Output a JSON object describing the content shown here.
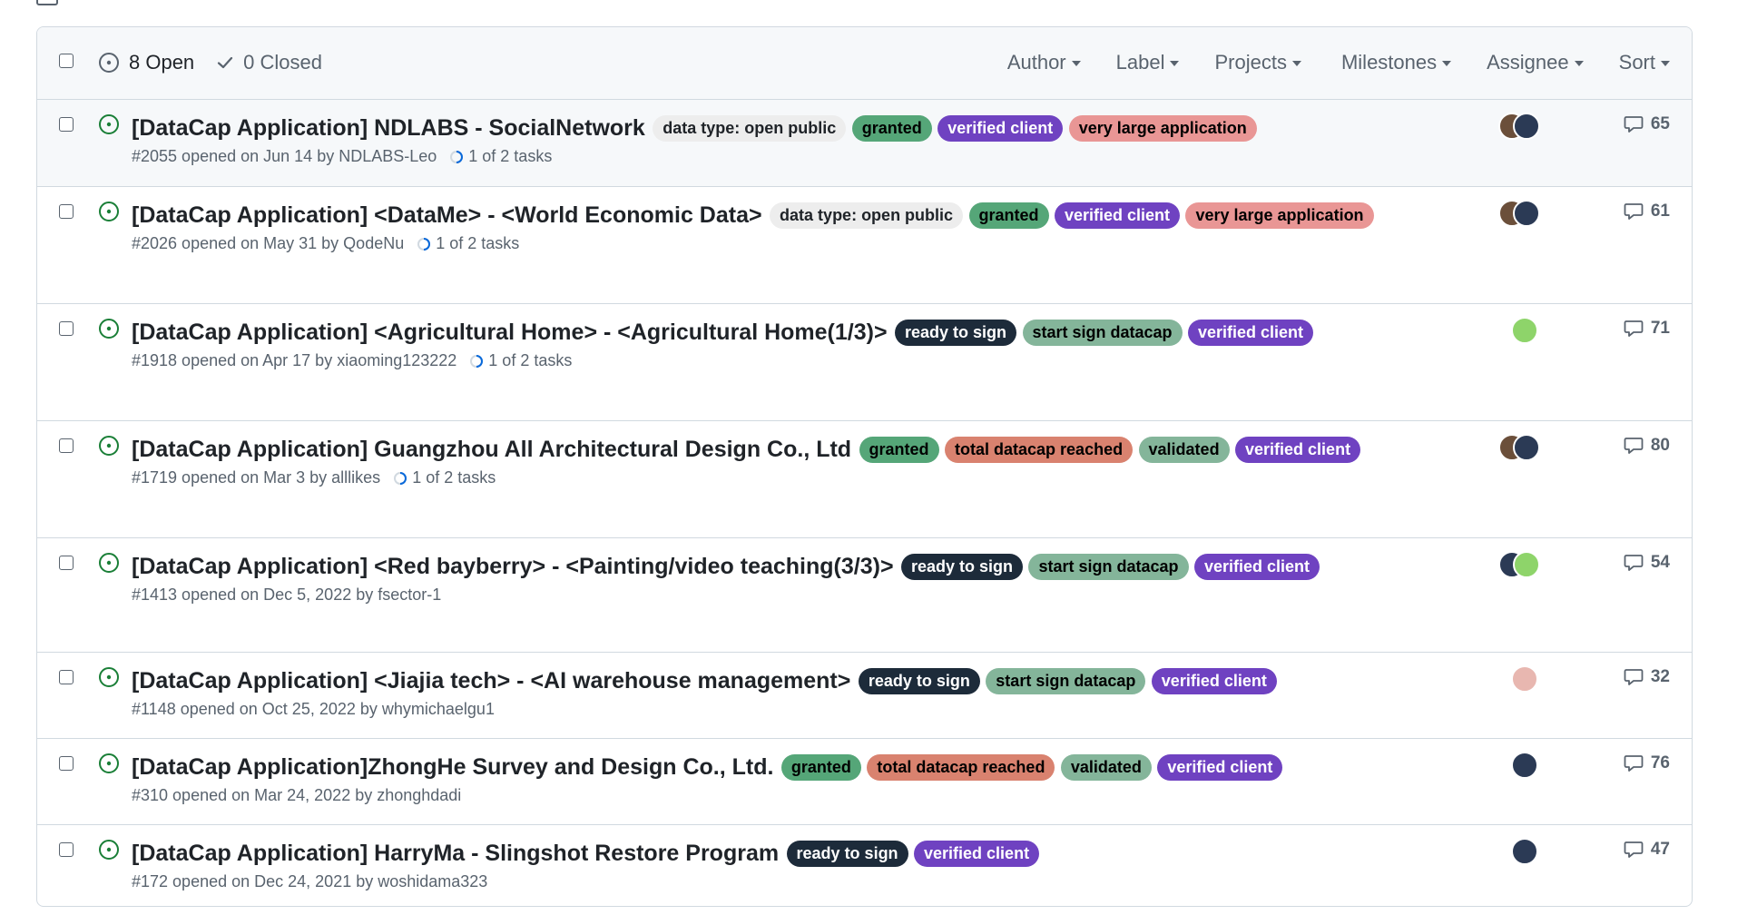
{
  "header": {
    "open_label": "8 Open",
    "closed_label": "0 Closed",
    "filters": [
      "Author",
      "Label",
      "Projects",
      "Milestones",
      "Assignee",
      "Sort"
    ]
  },
  "issues": [
    {
      "title": "[DataCap Application] NDLABS - SocialNetwork",
      "labels": [
        {
          "text": "data type: open public",
          "bg": "#ededed",
          "fg": "#1f2328"
        },
        {
          "text": "granted",
          "bg": "#55a678",
          "fg": "#000000"
        },
        {
          "text": "verified client",
          "bg": "#6f42c1",
          "fg": "#ffffff"
        },
        {
          "text": "very large application",
          "bg": "#e99695",
          "fg": "#000000"
        }
      ],
      "meta": "#2055 opened on Jun 14 by NDLABS-Leo",
      "tasks": "1 of 2 tasks",
      "comments": "65",
      "avatars": [
        "#6b4f3a",
        "#2b3a55"
      ]
    },
    {
      "title": "[DataCap Application] <DataMe> - <World Economic Data>",
      "labels": [
        {
          "text": "data type: open public",
          "bg": "#ededed",
          "fg": "#1f2328"
        },
        {
          "text": "granted",
          "bg": "#55a678",
          "fg": "#000000"
        },
        {
          "text": "verified client",
          "bg": "#6f42c1",
          "fg": "#ffffff"
        },
        {
          "text": "very large application",
          "bg": "#e99695",
          "fg": "#000000"
        }
      ],
      "meta": "#2026 opened on May 31 by QodeNu",
      "tasks": "1 of 2 tasks",
      "comments": "61",
      "avatars": [
        "#6b4f3a",
        "#2b3a55"
      ]
    },
    {
      "title": "[DataCap Application] <Agricultural Home> - <Agricultural Home(1/3)>",
      "labels": [
        {
          "text": "ready to sign",
          "bg": "#1d2b3a",
          "fg": "#ffffff"
        },
        {
          "text": "start sign datacap",
          "bg": "#84b59a",
          "fg": "#000000"
        },
        {
          "text": "verified client",
          "bg": "#6f42c1",
          "fg": "#ffffff"
        }
      ],
      "meta": "#1918 opened on Apr 17 by xiaoming123222",
      "tasks": "1 of 2 tasks",
      "comments": "71",
      "avatars": [
        "#8ed46a"
      ]
    },
    {
      "title": "[DataCap Application] Guangzhou All Architectural Design Co., Ltd",
      "labels": [
        {
          "text": "granted",
          "bg": "#55a678",
          "fg": "#000000"
        },
        {
          "text": "total datacap reached",
          "bg": "#d9826f",
          "fg": "#000000"
        },
        {
          "text": "validated",
          "bg": "#84b59a",
          "fg": "#000000"
        },
        {
          "text": "verified client",
          "bg": "#6f42c1",
          "fg": "#ffffff"
        }
      ],
      "meta": "#1719 opened on Mar 3 by alllikes",
      "tasks": "1 of 2 tasks",
      "comments": "80",
      "avatars": [
        "#6b4f3a",
        "#2b3a55"
      ]
    },
    {
      "title": "[DataCap Application] <Red bayberry> - <Painting/video teaching(3/3)>",
      "labels": [
        {
          "text": "ready to sign",
          "bg": "#1d2b3a",
          "fg": "#ffffff"
        },
        {
          "text": "start sign datacap",
          "bg": "#84b59a",
          "fg": "#000000"
        },
        {
          "text": "verified client",
          "bg": "#6f42c1",
          "fg": "#ffffff"
        }
      ],
      "meta": "#1413 opened on Dec 5, 2022 by fsector-1",
      "tasks": "",
      "comments": "54",
      "avatars": [
        "#2b3a55",
        "#8ed46a"
      ]
    },
    {
      "title": "[DataCap Application] <Jiajia tech> - <AI warehouse management>",
      "labels": [
        {
          "text": "ready to sign",
          "bg": "#1d2b3a",
          "fg": "#ffffff"
        },
        {
          "text": "start sign datacap",
          "bg": "#84b59a",
          "fg": "#000000"
        },
        {
          "text": "verified client",
          "bg": "#6f42c1",
          "fg": "#ffffff"
        }
      ],
      "meta": "#1148 opened on Oct 25, 2022 by whymichaelgu1",
      "tasks": "",
      "comments": "32",
      "avatars": [
        "#e8b7b0"
      ]
    },
    {
      "title": "[DataCap Application]ZhongHe Survey and Design Co., Ltd.",
      "labels": [
        {
          "text": "granted",
          "bg": "#55a678",
          "fg": "#000000"
        },
        {
          "text": "total datacap reached",
          "bg": "#d9826f",
          "fg": "#000000"
        },
        {
          "text": "validated",
          "bg": "#84b59a",
          "fg": "#000000"
        },
        {
          "text": "verified client",
          "bg": "#6f42c1",
          "fg": "#ffffff"
        }
      ],
      "meta": "#310 opened on Mar 24, 2022 by zhonghdadi",
      "tasks": "",
      "comments": "76",
      "avatars": [
        "#2b3a55"
      ]
    },
    {
      "title": "[DataCap Application] HarryMa - Slingshot Restore Program",
      "labels": [
        {
          "text": "ready to sign",
          "bg": "#1d2b3a",
          "fg": "#ffffff"
        },
        {
          "text": "verified client",
          "bg": "#6f42c1",
          "fg": "#ffffff"
        }
      ],
      "meta": "#172 opened on Dec 24, 2021 by woshidama323",
      "tasks": "",
      "comments": "47",
      "avatars": [
        "#2b3a55"
      ]
    }
  ]
}
